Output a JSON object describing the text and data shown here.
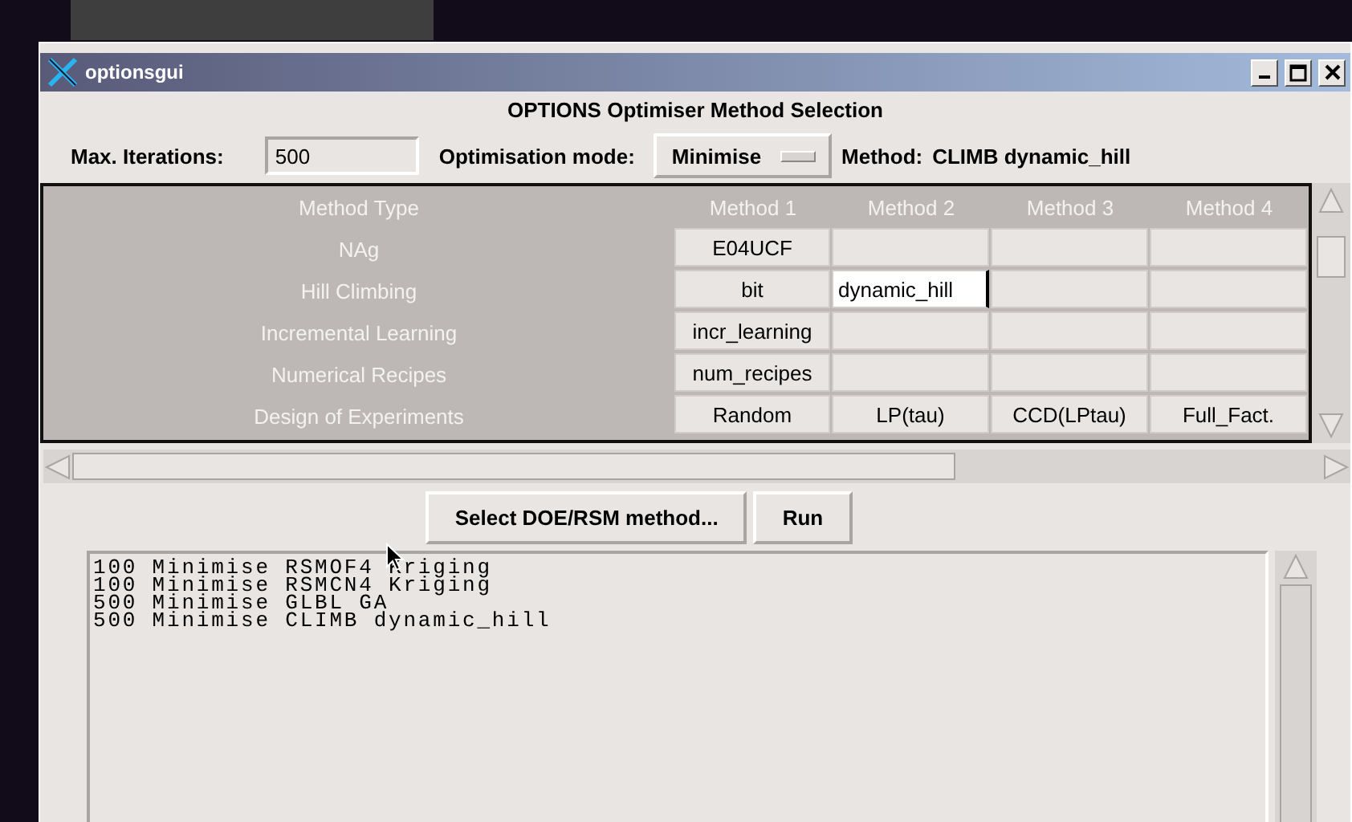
{
  "window": {
    "title": "optionsgui",
    "heading": "OPTIONS Optimiser Method Selection"
  },
  "controls": {
    "iterations_label": "Max. Iterations:",
    "iterations_value": "500",
    "mode_label": "Optimisation mode:",
    "mode_value": "Minimise",
    "method_label": "Method:",
    "method_value": "CLIMB dynamic_hill"
  },
  "table": {
    "columns": [
      "Method Type",
      "Method 1",
      "Method 2",
      "Method 3",
      "Method 4"
    ],
    "rows": [
      {
        "cells": [
          {
            "kind": "label",
            "text": "NAg"
          },
          {
            "kind": "entry",
            "text": "E04UCF",
            "selected": false
          },
          {
            "kind": "entry",
            "selected": false
          },
          {
            "kind": "entry",
            "selected": false
          },
          {
            "kind": "entry",
            "selected": false
          }
        ]
      },
      {
        "cells": [
          {
            "kind": "label",
            "text": "Hill Climbing"
          },
          {
            "kind": "entry",
            "text": "bit",
            "selected": false
          },
          {
            "kind": "entry",
            "text": "dynamic_hill",
            "selected": true
          },
          {
            "kind": "entry",
            "selected": false
          },
          {
            "kind": "entry",
            "selected": false
          }
        ]
      },
      {
        "cells": [
          {
            "kind": "label",
            "text": "Incremental Learning"
          },
          {
            "kind": "entry",
            "text": "incr_learning",
            "selected": false
          },
          {
            "kind": "entry",
            "selected": false
          },
          {
            "kind": "entry",
            "selected": false
          },
          {
            "kind": "entry",
            "selected": false
          }
        ]
      },
      {
        "cells": [
          {
            "kind": "label",
            "text": "Numerical Recipes"
          },
          {
            "kind": "entry",
            "text": "num_recipes",
            "selected": false
          },
          {
            "kind": "entry",
            "selected": false
          },
          {
            "kind": "entry",
            "selected": false
          },
          {
            "kind": "entry",
            "selected": false
          }
        ]
      },
      {
        "cells": [
          {
            "kind": "label",
            "text": "Design of Experiments"
          },
          {
            "kind": "entry",
            "text": "Random",
            "selected": false
          },
          {
            "kind": "entry",
            "text": "LP(tau)",
            "selected": false
          },
          {
            "kind": "entry",
            "text": "CCD(LPtau)",
            "selected": false
          },
          {
            "kind": "entry",
            "text": "Full_Fact.",
            "selected": false
          }
        ]
      }
    ]
  },
  "buttons": [
    "Select DOE/RSM method...",
    "Run"
  ],
  "log": [
    "100 Minimise RSMOF4 Kriging",
    "100 Minimise RSMCN4 Kriging",
    "500 Minimise GLBL GA",
    "500 Minimise CLIMB dynamic_hill"
  ]
}
